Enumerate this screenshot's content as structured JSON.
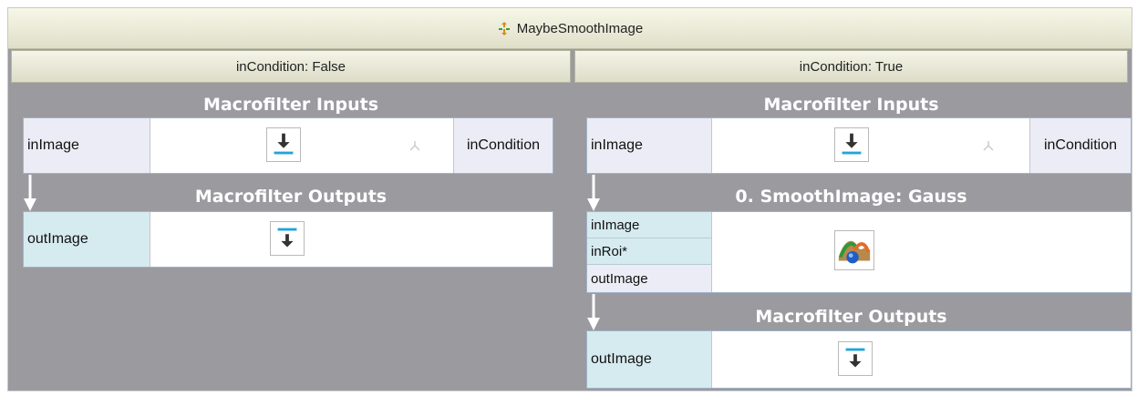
{
  "macrofilter": {
    "title": "MaybeSmoothImage",
    "icon": "macrofilter-icon"
  },
  "variants": [
    {
      "header": "inCondition: False",
      "inputs_title": "Macrofilter Inputs",
      "inputs": {
        "left_port": "inImage",
        "right_port": "inCondition"
      },
      "outputs_title": "Macrofilter Outputs",
      "outputs": {
        "port": "outImage"
      }
    },
    {
      "header": "inCondition: True",
      "inputs_title": "Macrofilter Inputs",
      "inputs": {
        "left_port": "inImage",
        "right_port": "inCondition"
      },
      "filter_title": "0. SmoothImage: Gauss",
      "filter": {
        "ports": [
          "inImage",
          "inRoi*",
          "outImage"
        ],
        "icon": "smooth-image-icon"
      },
      "outputs_title": "Macrofilter Outputs",
      "outputs": {
        "port": "outImage"
      }
    }
  ],
  "colors": {
    "canvas": "#9a9a9f",
    "header": "#dfdfc9",
    "input_port": "#ececf6",
    "output_port": "#d6ebf0",
    "accent": "#22a3d8"
  }
}
